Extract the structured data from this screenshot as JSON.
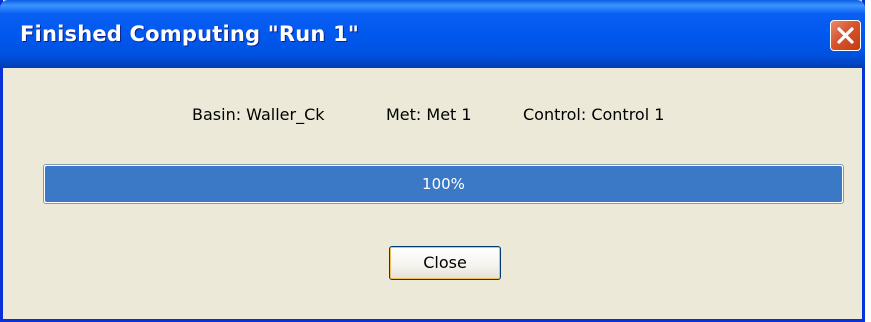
{
  "window": {
    "title": "Finished Computing \"Run 1\"",
    "close_icon": "close-x-icon"
  },
  "info": {
    "basin": "Basin: Waller_Ck",
    "met": "Met: Met 1",
    "control": "Control: Control 1"
  },
  "progress": {
    "value": 100,
    "label": "100%"
  },
  "buttons": {
    "close_label": "Close"
  },
  "colors": {
    "titlebar": "#0058ee",
    "progress_fill": "#3b79c6",
    "dialog_bg": "#ece9d8",
    "close_button": "#d8542e"
  }
}
